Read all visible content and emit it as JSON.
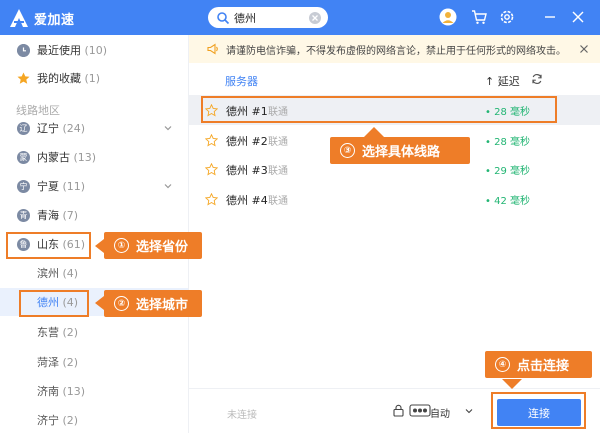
{
  "app": {
    "title": "爱加速"
  },
  "search": {
    "value": "德州"
  },
  "sidebar": {
    "recent": {
      "label": "最近使用",
      "count": "(10)"
    },
    "favorites": {
      "label": "我的收藏",
      "count": "(1)"
    },
    "section_title": "线路地区",
    "regions": [
      {
        "label": "辽宁",
        "count": "(24)",
        "badge": "辽"
      },
      {
        "label": "内蒙古",
        "count": "(13)",
        "badge": "蒙"
      },
      {
        "label": "宁夏",
        "count": "(11)",
        "badge": "宁"
      },
      {
        "label": "青海",
        "count": "(7)",
        "badge": "青"
      },
      {
        "label": "山东",
        "count": "(61)",
        "badge": "鲁"
      }
    ],
    "cities": [
      {
        "label": "滨州",
        "count": "(4)"
      },
      {
        "label": "德州",
        "count": "(4)"
      },
      {
        "label": "东营",
        "count": "(2)"
      },
      {
        "label": "菏泽",
        "count": "(2)"
      },
      {
        "label": "济南",
        "count": "(13)"
      },
      {
        "label": "济宁",
        "count": "(2)"
      }
    ]
  },
  "notice": {
    "text": "请谨防电信诈骗，不得发布虚假的网络言论，禁止用于任何形式的网络攻击。"
  },
  "server_list": {
    "header_server": "服务器",
    "header_latency": "↑ 延迟",
    "servers": [
      {
        "name": "德州 #1",
        "isp": "联通",
        "latency": "• 28 毫秒"
      },
      {
        "name": "德州 #2",
        "isp": "联通",
        "latency": "• 28 毫秒"
      },
      {
        "name": "德州 #3",
        "isp": "联通",
        "latency": "• 29 毫秒"
      },
      {
        "name": "德州 #4",
        "isp": "联通",
        "latency": "• 42 毫秒"
      }
    ]
  },
  "bottom": {
    "status": "未连接",
    "mode": "自动",
    "connect_label": "连接"
  },
  "annotations": {
    "step1": {
      "num": "①",
      "text": "选择省份"
    },
    "step2": {
      "num": "②",
      "text": "选择城市"
    },
    "step3": {
      "num": "③",
      "text": "选择具体线路"
    },
    "step4": {
      "num": "④",
      "text": "点击连接"
    }
  },
  "colors": {
    "brand": "#4183f4",
    "accent": "#ee7d28",
    "latency": "#22b573"
  }
}
